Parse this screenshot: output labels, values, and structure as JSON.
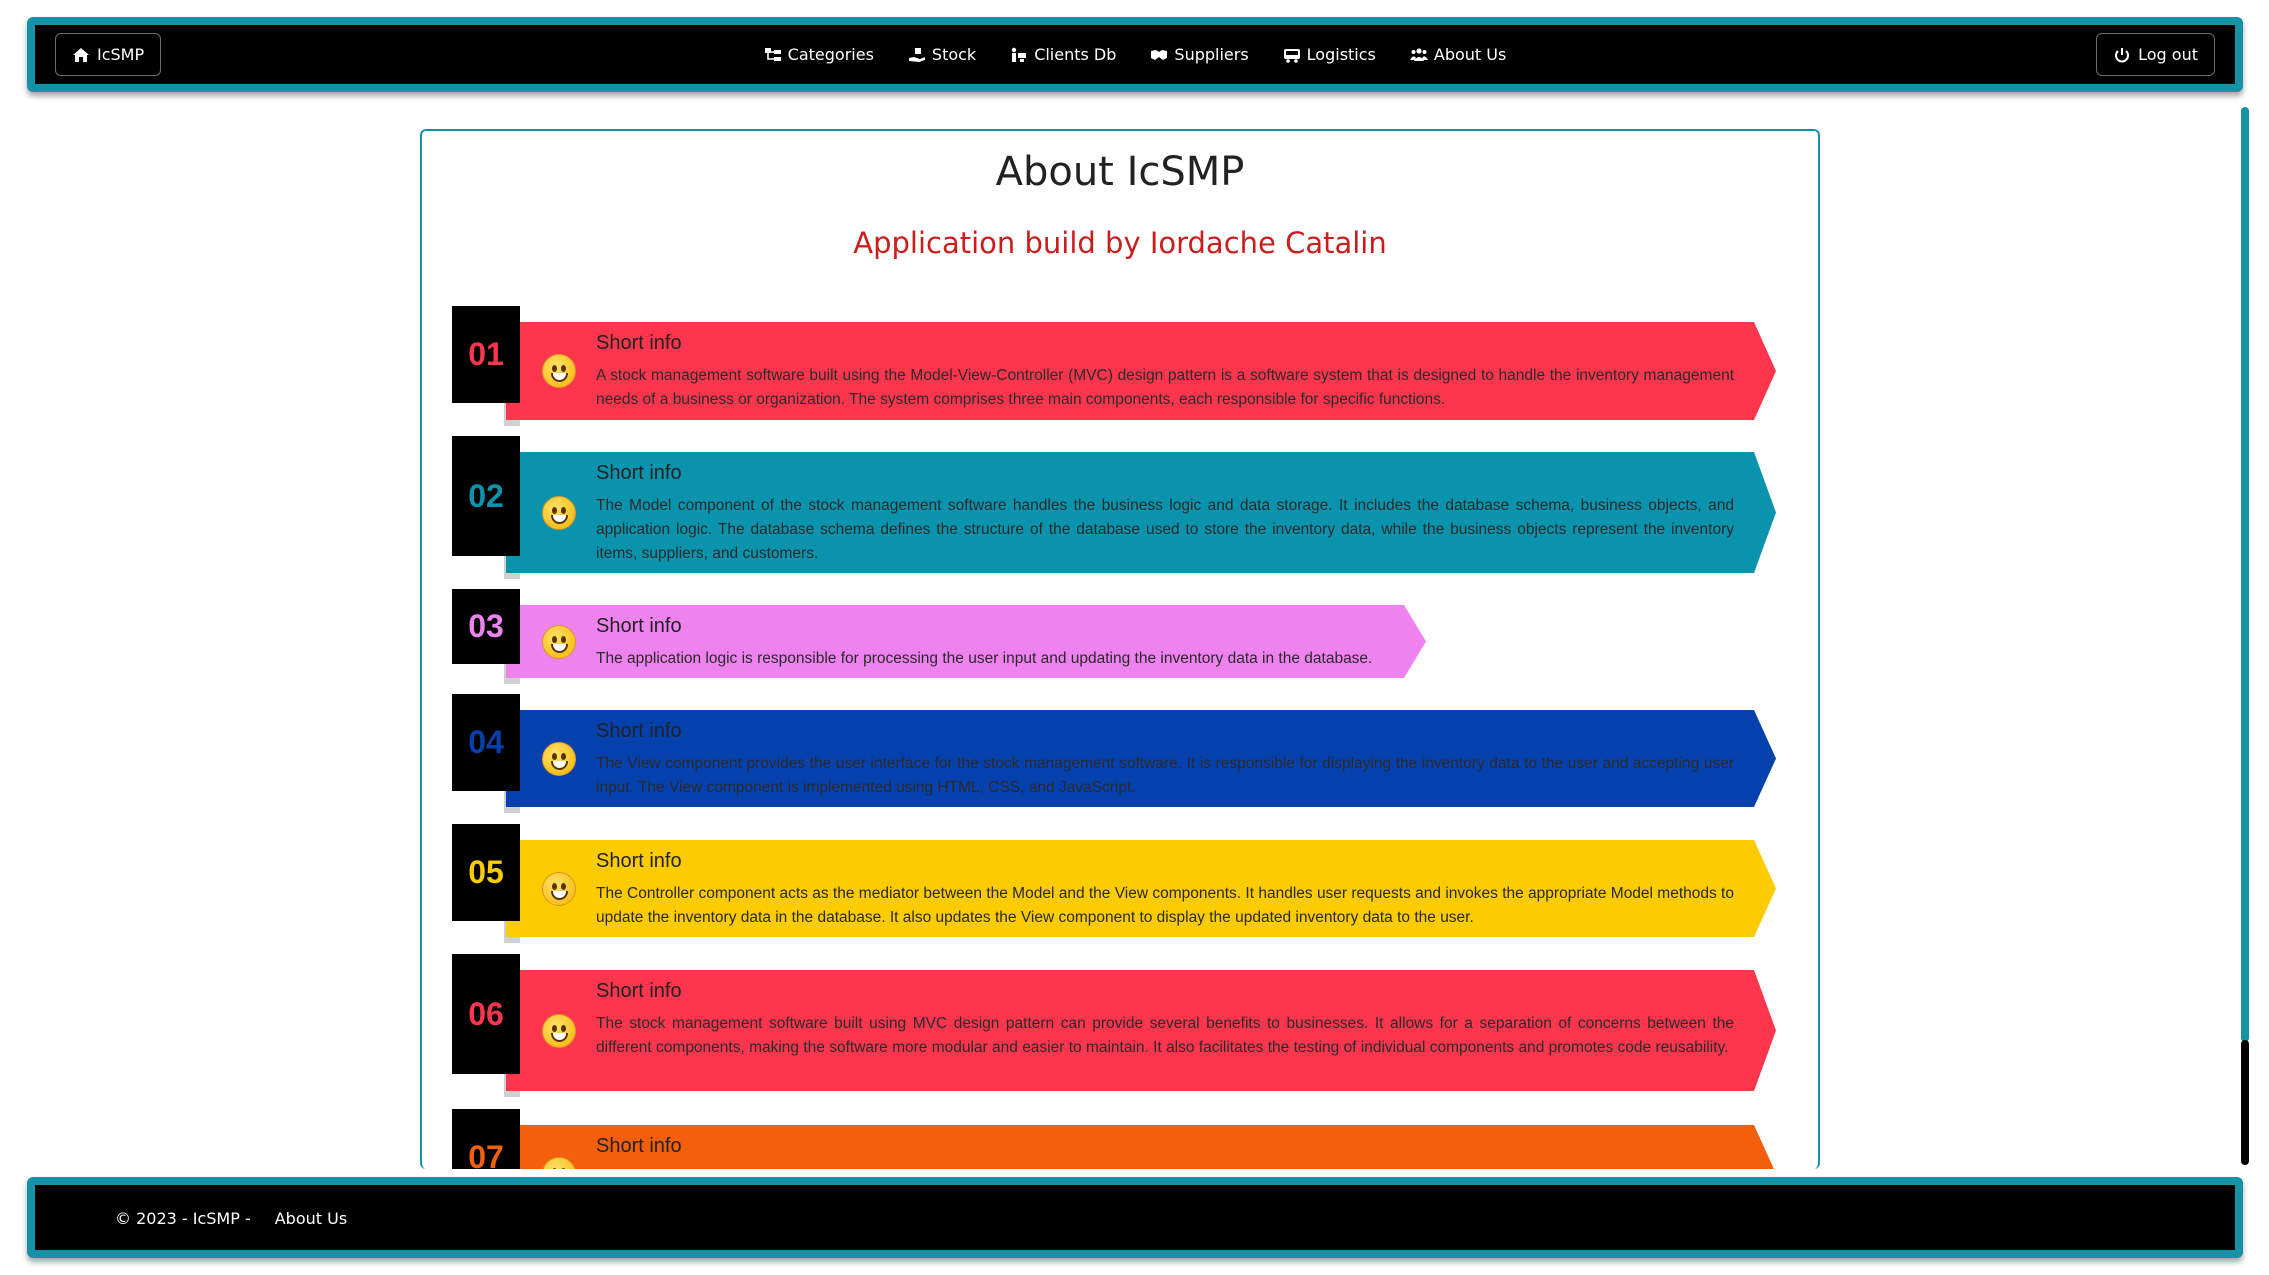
{
  "navbar": {
    "brand": "IcSMP",
    "links": [
      {
        "label": "Categories",
        "icon": "sitemap-icon"
      },
      {
        "label": "Stock",
        "icon": "hand-box-icon"
      },
      {
        "label": "Clients Db",
        "icon": "people-carry-icon"
      },
      {
        "label": "Suppliers",
        "icon": "handshake-icon"
      },
      {
        "label": "Logistics",
        "icon": "truck-icon"
      },
      {
        "label": "About Us",
        "icon": "users-icon"
      }
    ],
    "logout": "Log out"
  },
  "main": {
    "title": "About IcSMP",
    "subtitle": "Application build by Iordache Catalin",
    "items": [
      {
        "num": "01",
        "title": "Short info",
        "color": "#fd364d",
        "num_color": "#fd364d",
        "text": "A stock management software built using the Model-View-Controller (MVC) design pattern is a software system that is designed to handle the inventory management needs of a business or organization. The system comprises three main components, each responsible for specific functions."
      },
      {
        "num": "02",
        "title": "Short info",
        "color": "#0a93ad",
        "num_color": "#0a93ad",
        "text": "The Model component of the stock management software handles the business logic and data storage. It includes the database schema, business objects, and application logic. The database schema defines the structure of the database used to store the inventory data, while the business objects represent the inventory items, suppliers, and customers."
      },
      {
        "num": "03",
        "title": "Short info",
        "color": "#ee82ee",
        "num_color": "#ee82ee",
        "text": "The application logic is responsible for processing the user input and updating the inventory data in the database."
      },
      {
        "num": "04",
        "title": "Short info",
        "color": "#0541ad",
        "num_color": "#0541ad",
        "text": "The View component provides the user interface for the stock management software. It is responsible for displaying the inventory data to the user and accepting user input. The View component is implemented using HTML, CSS, and JavaScript."
      },
      {
        "num": "05",
        "title": "Short info",
        "color": "#fccb00",
        "num_color": "#fccb00",
        "text": "The Controller component acts as the mediator between the Model and the View components. It handles user requests and invokes the appropriate Model methods to update the inventory data in the database. It also updates the View component to display the updated inventory data to the user."
      },
      {
        "num": "06",
        "title": "Short info",
        "color": "#fd364d",
        "num_color": "#fd364d",
        "text": "The stock management software built using MVC design pattern can provide several benefits to businesses. It allows for a separation of concerns between the different components, making the software more modular and easier to maintain. It also facilitates the testing of individual components and promotes code reusability."
      },
      {
        "num": "07",
        "title": "Short info",
        "color": "#f45f0e",
        "num_color": "#f45f0e",
        "text": ""
      }
    ]
  },
  "footer": {
    "copyright": "© 2023 - IcSMP -",
    "link": "About Us"
  }
}
